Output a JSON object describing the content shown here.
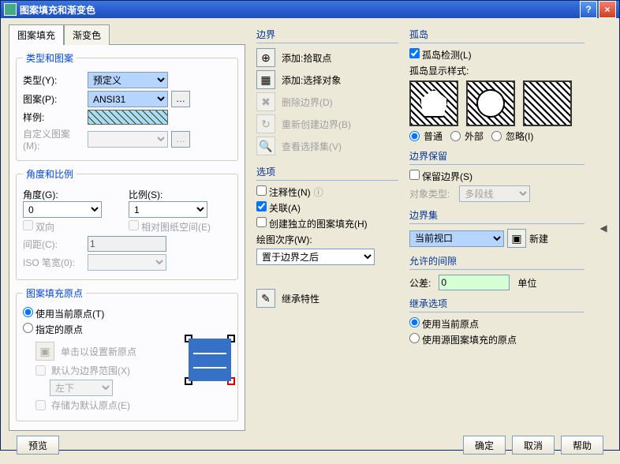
{
  "title": "图案填充和渐变色",
  "tabs": {
    "t1": "图案填充",
    "t2": "渐变色"
  },
  "typePattern": {
    "legend": "类型和图案",
    "typeLabel": "类型(Y):",
    "typeValue": "预定义",
    "patternLabel": "图案(P):",
    "patternValue": "ANSI31",
    "sampleLabel": "样例:",
    "customLabel": "自定义图案(M):"
  },
  "angleScale": {
    "legend": "角度和比例",
    "angleLabel": "角度(G):",
    "angleValue": "0",
    "scaleLabel": "比例(S):",
    "scaleValue": "1",
    "doubleLabel": "双向",
    "relPaperLabel": "相对图纸空间(E)",
    "spacingLabel": "间距(C):",
    "spacingValue": "1",
    "isoPenLabel": "ISO 笔宽(0):"
  },
  "origin": {
    "legend": "图案填充原点",
    "useCurrent": "使用当前原点(T)",
    "specified": "指定的原点",
    "clickNew": "单击以设置新原点",
    "defaultExtent": "默认为边界范围(X)",
    "pos": "左下",
    "storeDefault": "存储为默认原点(E)"
  },
  "boundary": {
    "title": "边界",
    "pick": "添加:拾取点",
    "select": "添加:选择对象",
    "remove": "删除边界(D)",
    "recreate": "重新创建边界(B)",
    "view": "查看选择集(V)"
  },
  "options": {
    "title": "选项",
    "annot": "注释性(N)",
    "assoc": "关联(A)",
    "indep": "创建独立的图案填充(H)",
    "drawOrderLabel": "绘图次序(W):",
    "drawOrderValue": "置于边界之后"
  },
  "inherit": "继承特性",
  "islands": {
    "title": "孤岛",
    "detect": "孤岛检测(L)",
    "styleLabel": "孤岛显示样式:",
    "normal": "普通",
    "outer": "外部",
    "ignore": "忽略(I)"
  },
  "boundRetain": {
    "title": "边界保留",
    "retain": "保留边界(S)",
    "objTypeLabel": "对象类型:",
    "objTypeValue": "多段线"
  },
  "boundSet": {
    "title": "边界集",
    "value": "当前视口",
    "newBtn": "新建"
  },
  "gap": {
    "title": "允许的间隙",
    "tolLabel": "公差:",
    "tolValue": "0",
    "unit": "单位"
  },
  "inheritOpt": {
    "title": "继承选项",
    "useCurrent": "使用当前原点",
    "useSource": "使用源图案填充的原点"
  },
  "footer": {
    "preview": "预览",
    "ok": "确定",
    "cancel": "取消",
    "help": "帮助"
  }
}
